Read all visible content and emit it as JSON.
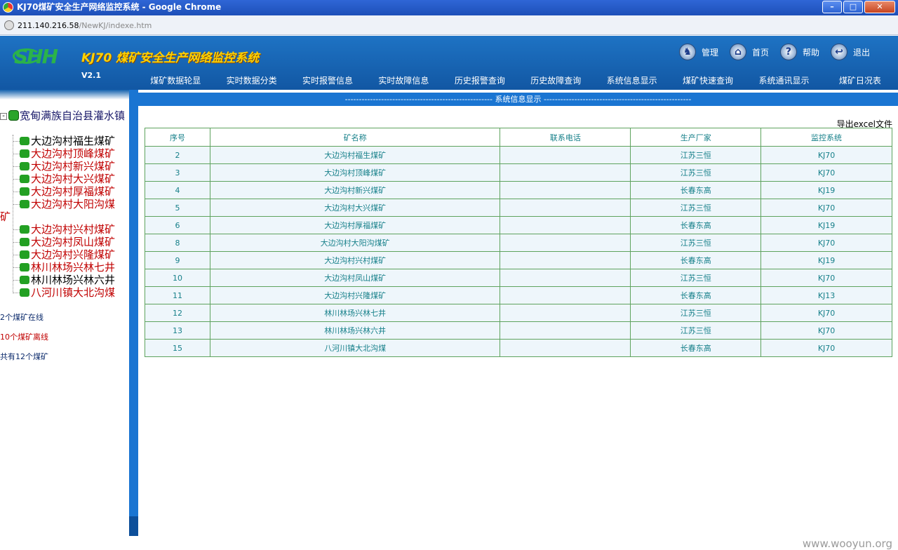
{
  "window": {
    "title": "KJ70煤矿安全生产网络监控系统 - Google Chrome",
    "url_host": "211.140.216.58",
    "url_path": "/NewKJ/indexe.htm"
  },
  "header": {
    "logo_text": "SHH",
    "app_title": "KJ70 煤矿安全生产网络监控系统",
    "version": "V2.1",
    "links": [
      {
        "label": "管理",
        "icon": "admin-icon"
      },
      {
        "label": "首页",
        "icon": "home-icon"
      },
      {
        "label": "帮助",
        "icon": "help-icon"
      },
      {
        "label": "退出",
        "icon": "exit-icon"
      }
    ]
  },
  "nav": {
    "items": [
      "煤矿数据轮显",
      "实时数据分类",
      "实时报警信息",
      "实时故障信息",
      "历史报警查询",
      "历史故障查询",
      "系统信息显示",
      "煤矿快速查询",
      "系统通讯显示",
      "煤矿日况表"
    ]
  },
  "sidebar": {
    "root_label": "宽甸满族自治县灌水镇",
    "items": [
      {
        "label": "大边沟村福生煤矿",
        "status": "online"
      },
      {
        "label": "大边沟村顶峰煤矿",
        "status": "offline"
      },
      {
        "label": "大边沟村新兴煤矿",
        "status": "offline"
      },
      {
        "label": "大边沟村大兴煤矿",
        "status": "offline"
      },
      {
        "label": "大边沟村厚福煤矿",
        "status": "offline"
      },
      {
        "label": "大边沟村大阳沟煤",
        "status": "offline"
      },
      {
        "label": "矿",
        "status": "offline"
      },
      {
        "label": "大边沟村兴村煤矿",
        "status": "offline"
      },
      {
        "label": "大边沟村凤山煤矿",
        "status": "offline"
      },
      {
        "label": "大边沟村兴隆煤矿",
        "status": "offline"
      },
      {
        "label": "林川林场兴林七井",
        "status": "offline"
      },
      {
        "label": "林川林场兴林六井",
        "status": "online"
      },
      {
        "label": "八河川镇大北沟煤",
        "status": "offline"
      }
    ],
    "stats": {
      "online": "2个煤矿在线",
      "offline": "10个煤矿离线",
      "total": "共有12个煤矿"
    }
  },
  "content": {
    "section_title": "----------------------------------------------------- 系统信息显示 -----------------------------------------------------",
    "export_label": "导出excel文件",
    "table": {
      "headers": [
        "序号",
        "矿名称",
        "联系电话",
        "生产厂家",
        "监控系统"
      ],
      "rows": [
        [
          "2",
          "大边沟村福生煤矿",
          "",
          "江苏三恒",
          "KJ70"
        ],
        [
          "3",
          "大边沟村顶峰煤矿",
          "",
          "江苏三恒",
          "KJ70"
        ],
        [
          "4",
          "大边沟村新兴煤矿",
          "",
          "长春东高",
          "KJ19"
        ],
        [
          "5",
          "大边沟村大兴煤矿",
          "",
          "江苏三恒",
          "KJ70"
        ],
        [
          "6",
          "大边沟村厚福煤矿",
          "",
          "长春东高",
          "KJ19"
        ],
        [
          "8",
          "大边沟村大阳沟煤矿",
          "",
          "江苏三恒",
          "KJ70"
        ],
        [
          "9",
          "大边沟村兴村煤矿",
          "",
          "长春东高",
          "KJ19"
        ],
        [
          "10",
          "大边沟村凤山煤矿",
          "",
          "江苏三恒",
          "KJ70"
        ],
        [
          "11",
          "大边沟村兴隆煤矿",
          "",
          "长春东高",
          "KJ13"
        ],
        [
          "12",
          "林川林场兴林七井",
          "",
          "江苏三恒",
          "KJ70"
        ],
        [
          "13",
          "林川林场兴林六井",
          "",
          "江苏三恒",
          "KJ70"
        ],
        [
          "15",
          "八河川镇大北沟煤",
          "",
          "长春东高",
          "KJ70"
        ]
      ]
    }
  },
  "footer": {
    "watermark": "www.wooyun.org"
  }
}
